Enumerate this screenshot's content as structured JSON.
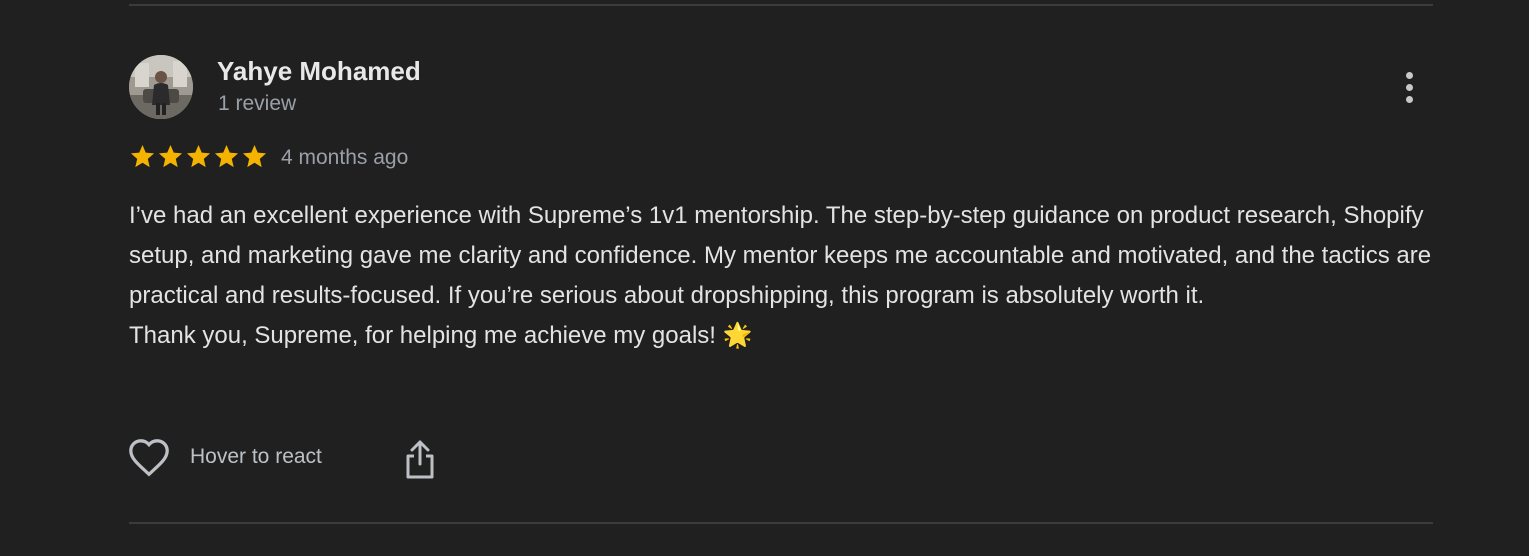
{
  "review": {
    "reviewer_name": "Yahye Mohamed",
    "review_count": "1 review",
    "rating": 5,
    "rating_max": 5,
    "date": "4 months ago",
    "text_lines": [
      "I’ve had an excellent experience with Supreme’s 1v1 mentorship. The step-by-step guidance on product research, Shopify setup, and marketing gave me clarity and confidence. My mentor keeps me accountable and motivated, and the tactics are practical and results-focused. If you’re serious about dropshipping, this program is absolutely worth it.",
      "Thank you, Supreme, for helping me achieve my goals! 🌟"
    ]
  },
  "actions": {
    "react_label": "Hover to react",
    "react_icon": "heart-outline-icon",
    "share_icon": "share-icon",
    "more_icon": "more-vertical-icon"
  },
  "colors": {
    "background": "#202020",
    "star": "#f5b301",
    "text": "#e3e3e3",
    "muted": "#9aa0a6"
  }
}
